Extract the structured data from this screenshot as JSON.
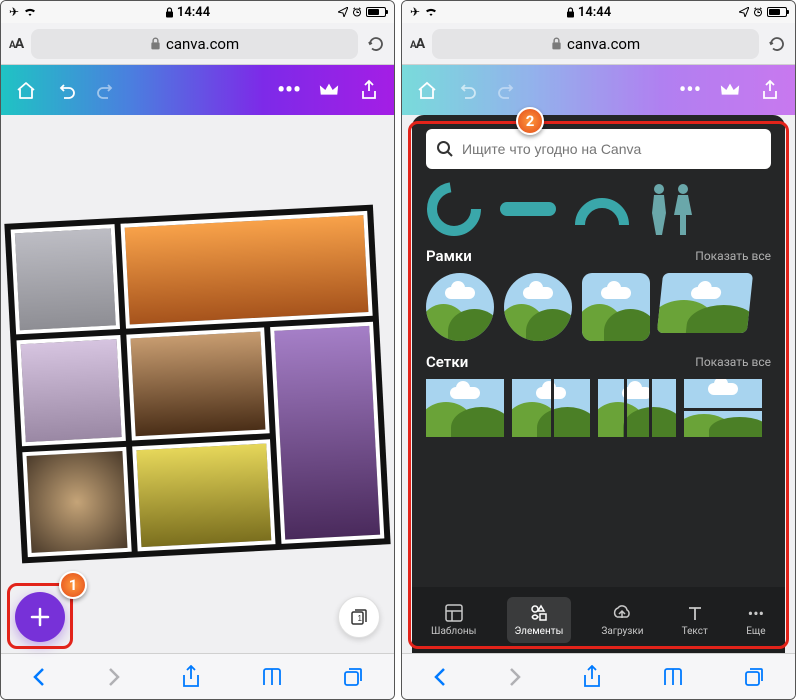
{
  "status": {
    "time": "14:44",
    "airplane": true
  },
  "safari": {
    "url": "canva.com",
    "aa_small": "A",
    "aa_big": "A"
  },
  "left": {
    "badge": "1",
    "page_count": "1"
  },
  "right": {
    "badge": "2",
    "search_placeholder": "Ищите что угодно на Canva",
    "sections": {
      "frames": {
        "title": "Рамки",
        "more": "Показать все"
      },
      "grids": {
        "title": "Сетки",
        "more": "Показать все"
      }
    },
    "tabs": {
      "templates": "Шаблоны",
      "elements": "Элементы",
      "uploads": "Загрузки",
      "text": "Текст",
      "more": "Еще"
    }
  }
}
